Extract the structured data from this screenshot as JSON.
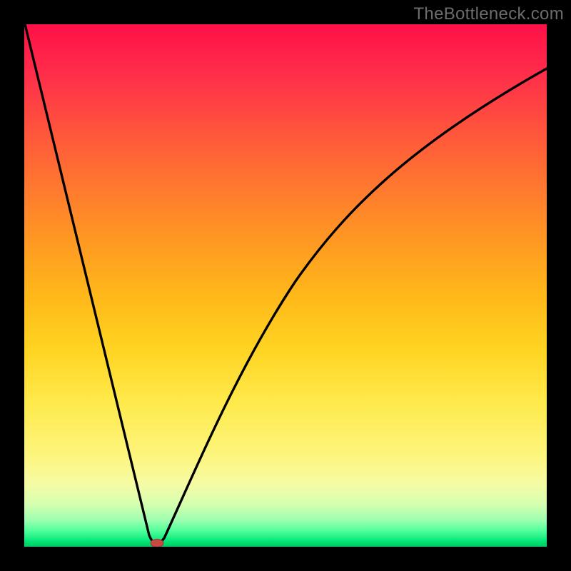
{
  "watermark": "TheBottleneck.com",
  "colors": {
    "frame": "#000000",
    "gradient_top": "#ff1048",
    "gradient_bottom": "#00c864",
    "curve": "#000000",
    "marker_fill": "#c74a42",
    "marker_stroke": "#9c3a34"
  },
  "chart_data": {
    "type": "line",
    "title": "",
    "xlabel": "",
    "ylabel": "",
    "xlim": [
      0,
      100
    ],
    "ylim": [
      0,
      100
    ],
    "grid": false,
    "ticks": "none",
    "series": [
      {
        "name": "bottleneck-curve",
        "x": [
          0,
          5,
          10,
          15,
          20,
          24,
          26,
          28,
          30,
          35,
          40,
          45,
          50,
          55,
          60,
          65,
          70,
          75,
          80,
          85,
          90,
          95,
          100
        ],
        "y": [
          100,
          79,
          58,
          38,
          17,
          1,
          0,
          4,
          13,
          29,
          43,
          54,
          63,
          70,
          76,
          80,
          84,
          87,
          89,
          91,
          92,
          93,
          93.5
        ]
      }
    ],
    "minimum_marker": {
      "x": 25.5,
      "y": 0
    },
    "notes": "No axis ticks or labels are rendered in the source image; values are read off the curve relative to the plot area (0–100 in each direction). The curve plunges linearly from top-left to a minimum near x≈25 then rises with a concave (log-like) shape toward the upper right, asymptoting near y≈93. A small reddish lozenge marker sits at the curve minimum."
  }
}
